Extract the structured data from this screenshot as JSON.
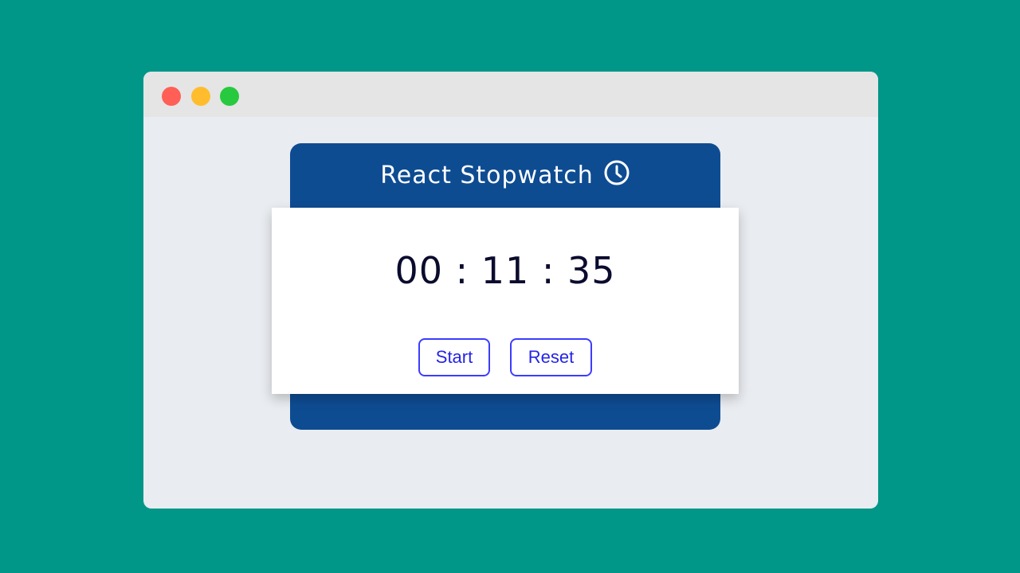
{
  "app": {
    "title": "React Stopwatch",
    "icon": "clock-icon"
  },
  "window": {
    "controls": [
      "close",
      "minimize",
      "maximize"
    ]
  },
  "timer": {
    "display": "00 : 11 : 35",
    "hours": "00",
    "minutes": "11",
    "seconds": "35"
  },
  "buttons": {
    "start_label": "Start",
    "reset_label": "Reset"
  },
  "colors": {
    "background": "#009688",
    "card": "#0e4c92",
    "button_accent": "#3c3cff",
    "close_dot": "#ff5f56",
    "minimize_dot": "#ffbd2e",
    "maximize_dot": "#27c93f"
  }
}
